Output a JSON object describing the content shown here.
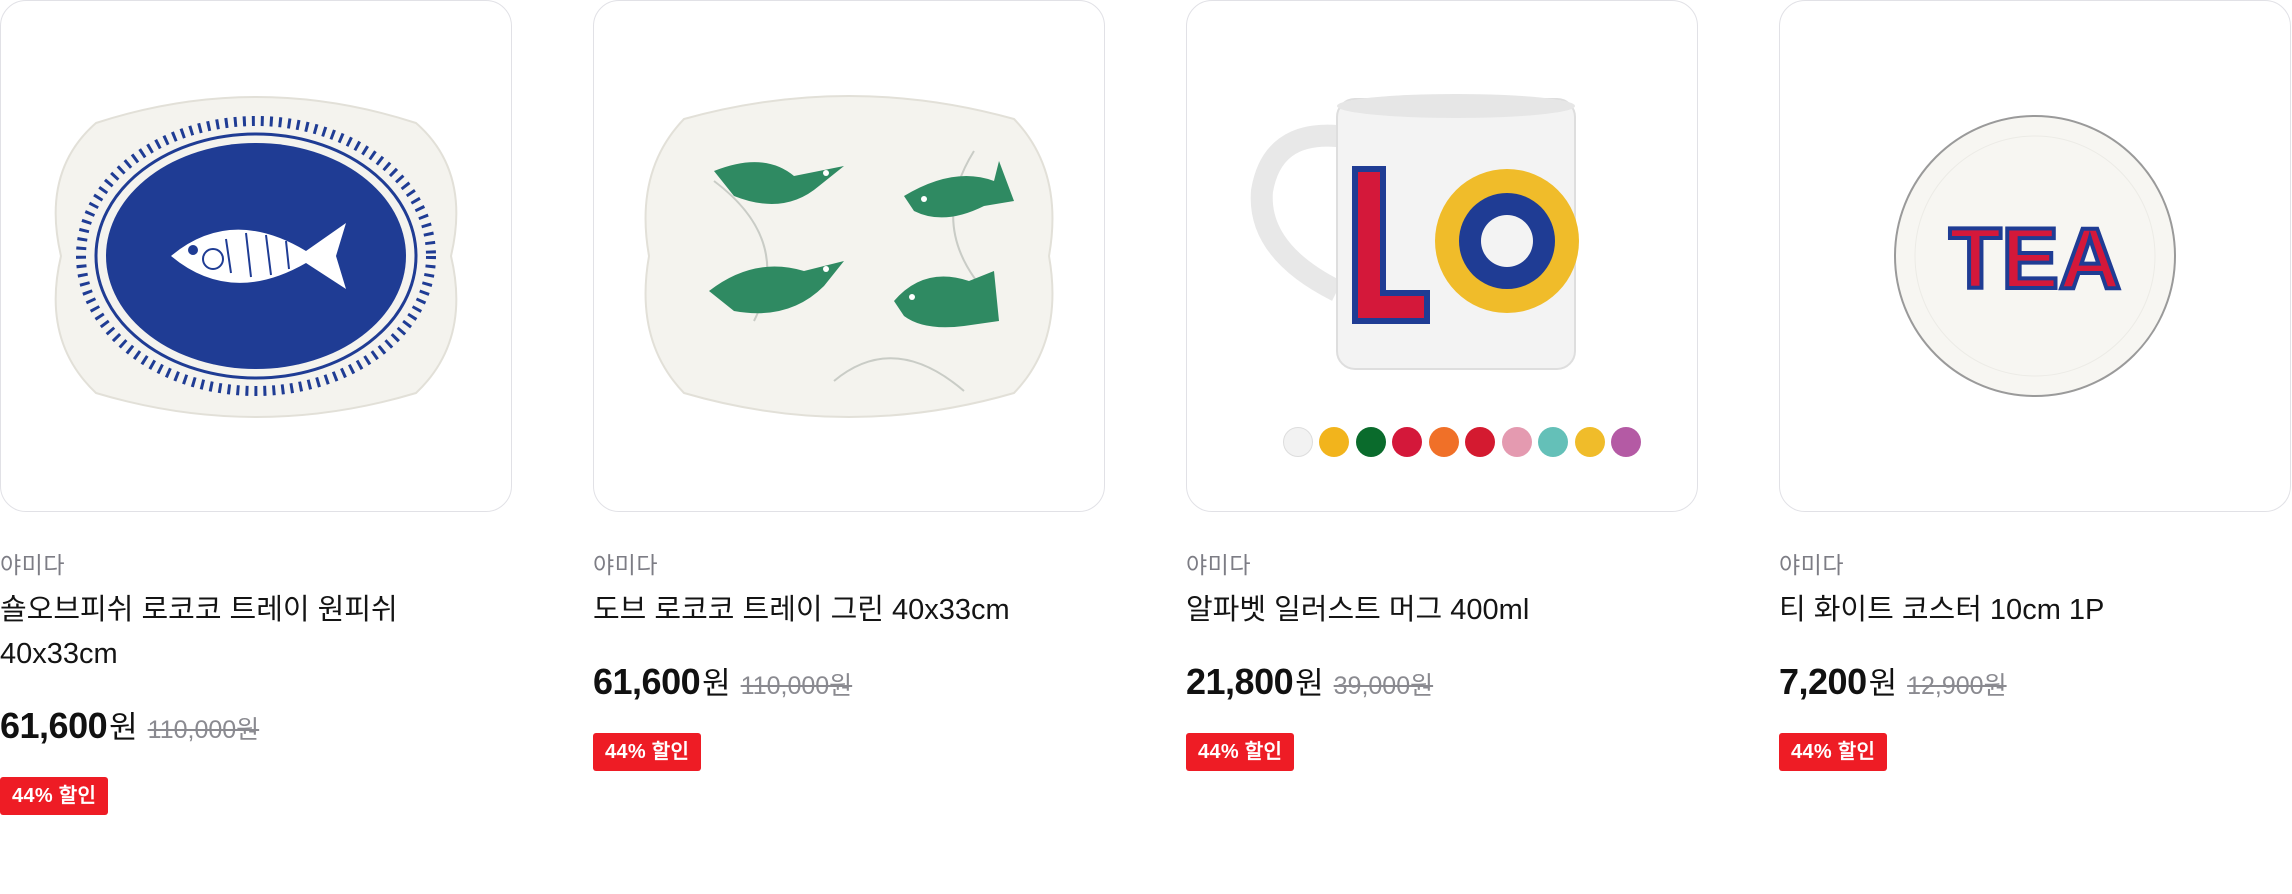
{
  "products": [
    {
      "brand": "야미다",
      "name": "숄오브피쉬 로코코 트레이 원피쉬 40x33cm",
      "price": "61,600",
      "currency": "원",
      "original_price": "110,000원",
      "discount_badge": "44% 할인",
      "image_icon": "fish-tray-icon"
    },
    {
      "brand": "야미다",
      "name": "도브 로코코 트레이 그린 40x33cm",
      "price": "61,600",
      "currency": "원",
      "original_price": "110,000원",
      "discount_badge": "44% 할인",
      "image_icon": "bird-tray-icon"
    },
    {
      "brand": "야미다",
      "name": "알파벳 일러스트 머그 400ml",
      "price": "21,800",
      "currency": "원",
      "original_price": "39,000원",
      "discount_badge": "44% 할인",
      "image_icon": "mug-icon",
      "image_text": "LO",
      "color_options": [
        "#f2f2f2",
        "#f2b41c",
        "#0a6b2c",
        "#d4183a",
        "#f07028",
        "#d41a30",
        "#e49ab0",
        "#64c0b8",
        "#f0bc2a",
        "#b45aa4"
      ]
    },
    {
      "brand": "야미다",
      "name": "티 화이트 코스터 10cm 1P",
      "price": "7,200",
      "currency": "원",
      "original_price": "12,900원",
      "discount_badge": "44% 할인",
      "image_icon": "coaster-icon",
      "image_text": "TEA"
    }
  ],
  "colors": {
    "discount_badge": "#ee1c25",
    "brand_text": "#7d7d85",
    "tray_blue": "#1f3c94",
    "bird_green": "#2f8a62"
  }
}
